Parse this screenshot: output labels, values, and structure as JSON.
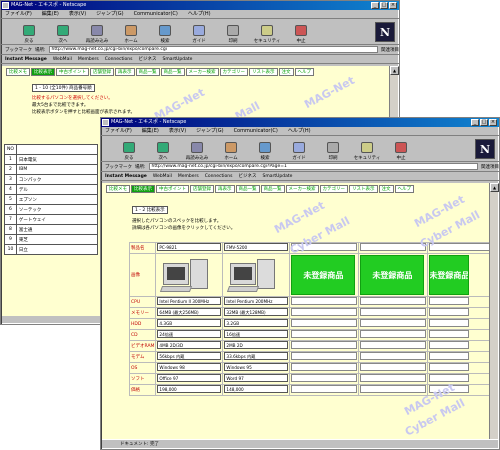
{
  "back_window": {
    "title": "MAG-Net - エキスポ - Netscape",
    "menu": [
      "ファイル(F)",
      "編集(E)",
      "表示(V)",
      "ジャンプ(G)",
      "Communicator(C)",
      "ヘルプ(H)"
    ],
    "toolbar": [
      "戻る",
      "次へ",
      "再読み込み",
      "ホーム",
      "検索",
      "ガイド",
      "印刷",
      "セキュリティ",
      "中止"
    ],
    "bookmarks_label": "ブックマーク",
    "location_label": "場所:",
    "url": "http://www.mag-net.co.jp/cgi-bin/expo/compare.cgi",
    "related_label": "関連項目",
    "links": [
      "Instant Message",
      "WebMail",
      "Members",
      "Connections",
      "ビジネス",
      "SmartUpdate"
    ],
    "tabs": [
      "比較メモ",
      "比較表示",
      "中古ポイント",
      "店舗登録",
      "再表示",
      "商品一覧",
      "商品一覧",
      "メーカー検索",
      "カテゴリー",
      "リスト表示",
      "注文",
      "ヘルプ"
    ],
    "page_select": "1 - 10 (全10件) 商品番号順",
    "notes": [
      "比較するパソコンを選択してください。",
      "最大5台まで比較できます。",
      "比較表示ボタンを押すと比較画面が表示されます。"
    ],
    "watermarks": [
      "MAG-Net",
      "Cyber Mall",
      "MAG-Net"
    ],
    "list_header": "NO",
    "list_rows": [
      {
        "no": "1",
        "name": "日本電気"
      },
      {
        "no": "2",
        "name": "IBM"
      },
      {
        "no": "3",
        "name": "コンパック"
      },
      {
        "no": "4",
        "name": "デル"
      },
      {
        "no": "5",
        "name": "エプソン"
      },
      {
        "no": "6",
        "name": "ソーテック"
      },
      {
        "no": "7",
        "name": "ゲートウェイ"
      },
      {
        "no": "8",
        "name": "富士通"
      },
      {
        "no": "9",
        "name": "東芝"
      },
      {
        "no": "10",
        "name": "日立"
      }
    ]
  },
  "front_window": {
    "title": "MAG-Net - エキスポ - Netscape",
    "menu": [
      "ファイル(F)",
      "編集(E)",
      "表示(V)",
      "ジャンプ(G)",
      "Communicator(C)",
      "ヘルプ(H)"
    ],
    "toolbar": [
      "戻る",
      "次へ",
      "再読み込み",
      "ホーム",
      "検索",
      "ガイド",
      "印刷",
      "セキュリティ",
      "中止"
    ],
    "bookmarks_label": "ブックマーク",
    "location_label": "場所:",
    "url": "http://www.mag-net.co.jp/cgi-bin/expo/compare.cgi?Page=1",
    "related_label": "関連項目",
    "links": [
      "Instant Message",
      "WebMail",
      "Members",
      "Connections",
      "ビジネス",
      "SmartUpdate"
    ],
    "tabs": [
      "比較メモ",
      "比較表示",
      "中古ポイント",
      "店舗登録",
      "再表示",
      "商品一覧",
      "商品一覧",
      "メーカー検索",
      "カテゴリー",
      "リスト表示",
      "注文",
      "ヘルプ"
    ],
    "page_select": "1 - 2 比較表示",
    "notes": [
      "選択したパソコンのスペックを比較します。",
      "詳細は各パソコンの画像をクリックしてください。"
    ],
    "watermarks": [
      "MAG-Net",
      "Cyber Mall",
      "MAG-Net",
      "Cyber Mall",
      "MAG-Net",
      "Cyber Mall"
    ],
    "row_labels": [
      "製品名",
      "画像",
      "CPU",
      "メモリー",
      "HDD",
      "CD",
      "ビデオRAM",
      "モデム",
      "OS",
      "ソフト",
      "価格"
    ],
    "products": [
      {
        "name": "PC-9821",
        "cpu": "Intel Pentium II 300MHz",
        "memory": "64MB (最大256MB)",
        "hdd": "4.3GB",
        "cd": "24倍速",
        "vram": "4MB 2D/3D",
        "modem": "56kbps 内蔵",
        "os": "Windows 98",
        "soft": "Office 97",
        "price": "198,000"
      },
      {
        "name": "FMV-5200",
        "cpu": "Intel Pentium 200MHz",
        "memory": "32MB (最大128MB)",
        "hdd": "3.2GB",
        "cd": "16倍速",
        "vram": "2MB 2D",
        "modem": "33.6kbps 内蔵",
        "os": "Windows 95",
        "soft": "Word 97",
        "price": "148,000"
      }
    ],
    "unregistered_label": "未登録商品",
    "status_items": [
      "ドキュメント: 完了"
    ]
  }
}
